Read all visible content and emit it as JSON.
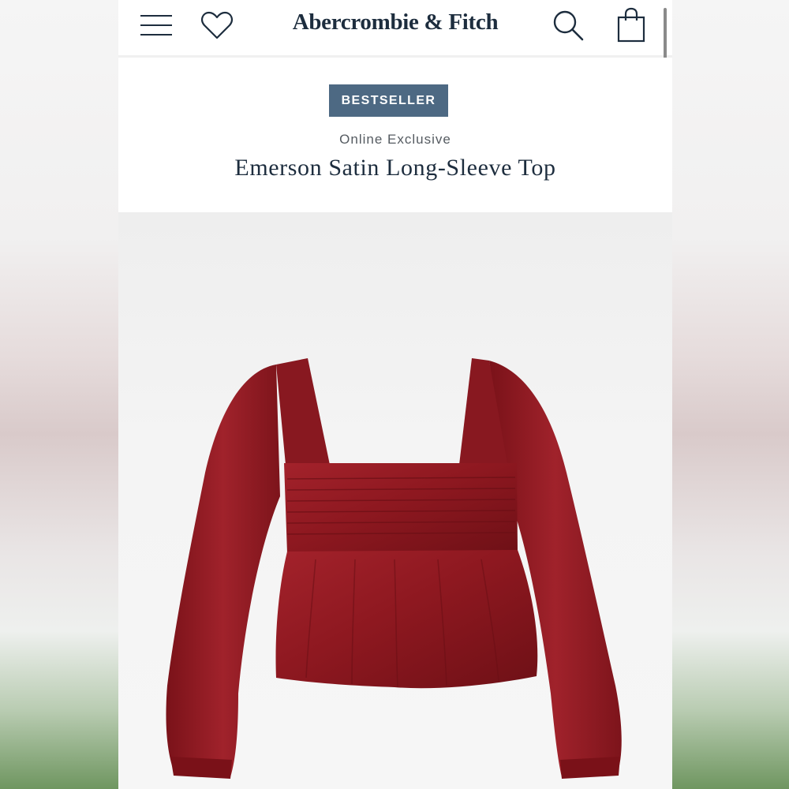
{
  "header": {
    "brand": "Abercrombie & Fitch",
    "icons": [
      "menu-icon",
      "heart-icon",
      "search-icon",
      "bag-icon"
    ]
  },
  "product": {
    "badge": "BESTSELLER",
    "subtitle": "Online Exclusive",
    "title": "Emerson Satin Long-Sleeve Top",
    "image_alt": "Emerson Satin Long-Sleeve Top",
    "garment_color": "#8e1820"
  },
  "colors": {
    "brand_navy": "#1d2d3e",
    "badge_bg": "#4d6983"
  }
}
